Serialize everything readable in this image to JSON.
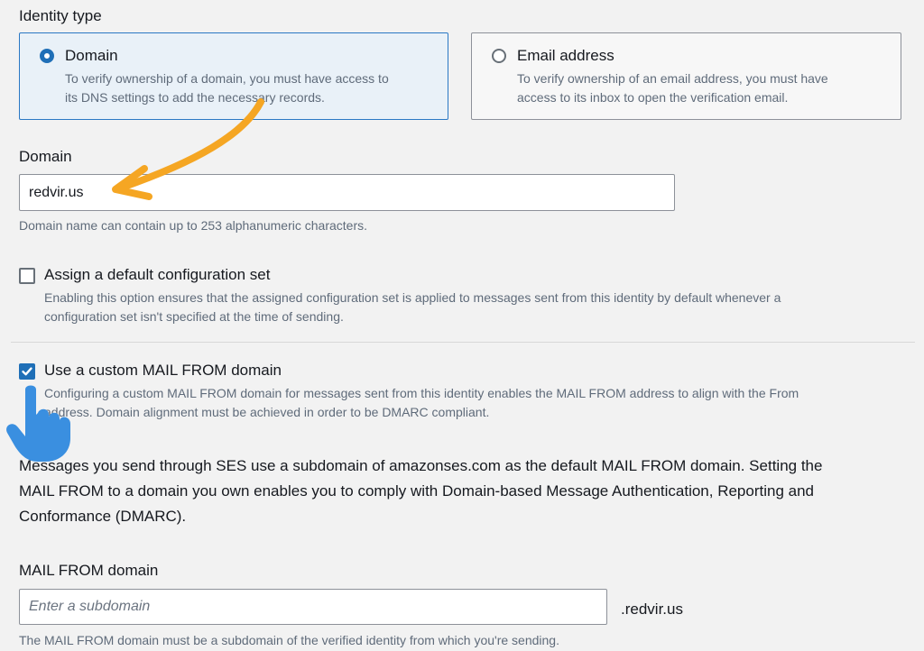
{
  "identity_type": {
    "label": "Identity type",
    "options": [
      {
        "title": "Domain",
        "description_line1": "To verify ownership of a domain, you must have access to",
        "description_line2": "its DNS settings to add the necessary records.",
        "selected": true
      },
      {
        "title": "Email address",
        "description_line1": "To verify ownership of an email address, you must have",
        "description_line2": "access to its inbox to open the verification email.",
        "selected": false
      }
    ]
  },
  "domain": {
    "label": "Domain",
    "value": "redvir.us",
    "hint": "Domain name can contain up to 253 alphanumeric characters."
  },
  "config_set": {
    "title": "Assign a default configuration set",
    "description_line1": "Enabling this option ensures that the assigned configuration set is applied to messages sent from this identity by default whenever a",
    "description_line2": "configuration set isn't specified at the time of sending.",
    "checked": false
  },
  "mail_from_checkbox": {
    "title": "Use a custom MAIL FROM domain",
    "description_line1": "Configuring a custom MAIL FROM domain for messages sent from this identity enables the MAIL FROM address to align with the From",
    "description_line2": "address. Domain alignment must be achieved in order to be DMARC compliant.",
    "checked": true
  },
  "info": {
    "line1": "Messages you send through SES use a subdomain of amazonses.com as the default MAIL FROM domain. Setting the",
    "line2": "MAIL FROM to a domain you own enables you to comply with Domain-based Message Authentication, Reporting and",
    "line3": "Conformance (DMARC)."
  },
  "mail_from_domain": {
    "label": "MAIL FROM domain",
    "placeholder": "Enter a subdomain",
    "suffix": ".redvir.us",
    "hint": "The MAIL FROM domain must be a subdomain of the verified identity from which you're sending."
  },
  "colors": {
    "accent": "#1f6fb7",
    "annotation_arrow": "#f5a623",
    "pointer_hand": "#3a8fe0"
  },
  "overlays": {
    "arrow": "curved-arrow-annotation",
    "hand": "pointer-hand-icon"
  }
}
